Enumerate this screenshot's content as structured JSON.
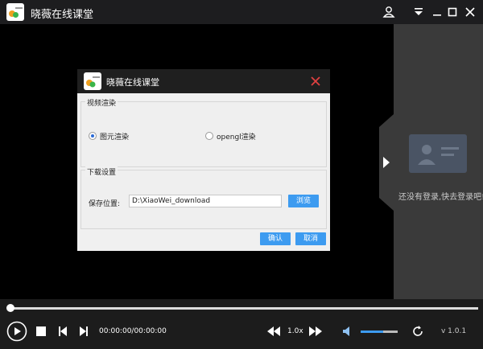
{
  "window": {
    "title": "晓薇在线课堂"
  },
  "sidebar": {
    "login_text": "还没有登录,快去登录吧!"
  },
  "dialog": {
    "title": "晓薇在线课堂",
    "render_group": {
      "legend": "视频渲染",
      "option1": "图元渲染",
      "option2": "opengl渲染",
      "selected": "图元渲染"
    },
    "download_group": {
      "legend": "下载设置",
      "path_label": "保存位置:",
      "path_value": "D:\\XiaoWei_download",
      "browse_label": "浏览"
    },
    "ok_label": "确认",
    "cancel_label": "取消"
  },
  "player": {
    "time": "00:00:00/00:00:00",
    "speed": "1.0x",
    "version": "v 1.0.1",
    "progress": 0,
    "volume": 0.6
  },
  "colors": {
    "accent": "#3d9bf0",
    "titlebar": "#1d1d1f",
    "sidebar": "#3a3a3a",
    "close": "#e04040"
  }
}
